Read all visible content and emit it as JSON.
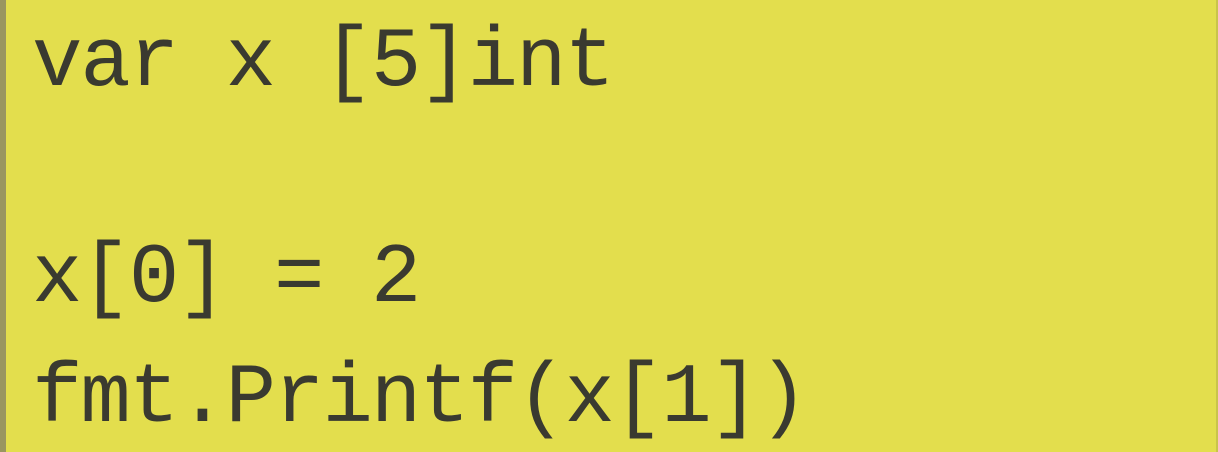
{
  "code": {
    "lines": [
      "var x [5]int",
      "x[0] = 2",
      "fmt.Printf(x[1])"
    ]
  }
}
